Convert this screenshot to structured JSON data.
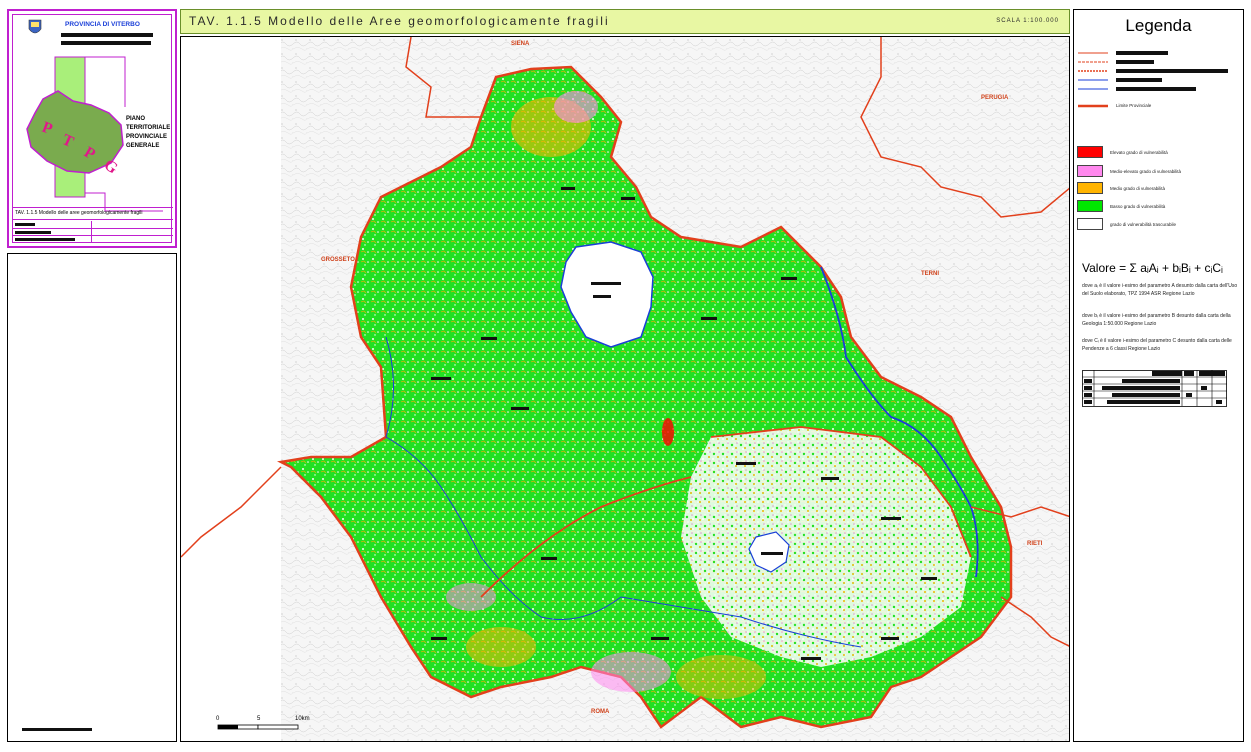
{
  "title_block": {
    "province": "PROVINCIA DI VITERBO",
    "logo_letters": "P.T.P.G.",
    "plan_name": "PIANO TERRITORIALE PROVINCIALE GENERALE",
    "plan_lines": [
      "PIANO",
      "TERRITORIALE",
      "PROVINCIALE",
      "GENERALE"
    ],
    "tav_caption": "TAV. 1.1.5 Modello delle aree geomorfologicamente fragili"
  },
  "header": {
    "title": "TAV. 1.1.5 Modello delle Aree geomorfologicamente fragili",
    "scale": "SCALA 1:100.000"
  },
  "map": {
    "cities": [
      {
        "name": "SIENA"
      },
      {
        "name": "PERUGIA"
      },
      {
        "name": "GROSSETO"
      },
      {
        "name": "TERNI"
      },
      {
        "name": "RIETI"
      },
      {
        "name": "ROMA"
      }
    ],
    "scalebar": {
      "ticks": [
        "0",
        "5",
        "10km"
      ]
    }
  },
  "legend": {
    "title": "Legenda",
    "limit_label": "Limite Provinciale",
    "classes": [
      {
        "label": "Elevato grado di vulnerabilità",
        "color": "#ff0000"
      },
      {
        "label": "Medio-elevato grado di vulnerabilità",
        "color": "#ff88ee"
      },
      {
        "label": "Medio grado di vulnerabilità",
        "color": "#ffb400"
      },
      {
        "label": "Basso grado di vulnerabilità",
        "color": "#00e600"
      },
      {
        "label": "grado di vulnerabilità trascurabile",
        "color": "#ffffff"
      }
    ],
    "formula": "Valore = Σ aᵢAᵢ + bᵢBᵢ + cᵢCᵢ",
    "notes": [
      "dove aᵢ è il valore i-esimo del parametro A desunto dalla carta dell'Uso del Suolo elaborato, TPZ 1994 ASR Regione Lazio",
      "dove bᵢ è il valore i-esimo del parametro B desunto dalla carta della Geologia 1:50.000 Regione Lazio",
      "dove Cᵢ è il valore i-esimo del parametro C desunto dalla carta delle Pendenze a 6 classi Regione Lazio"
    ]
  },
  "colors": {
    "low": "#00e600",
    "medium": "#ffb400",
    "medium_high": "#ff88ee",
    "high": "#ff0000",
    "boundary": "#e2401c",
    "river": "#1a3fd8",
    "title_bar": "#e8f7a3",
    "frame_border": "#c01fcf"
  }
}
